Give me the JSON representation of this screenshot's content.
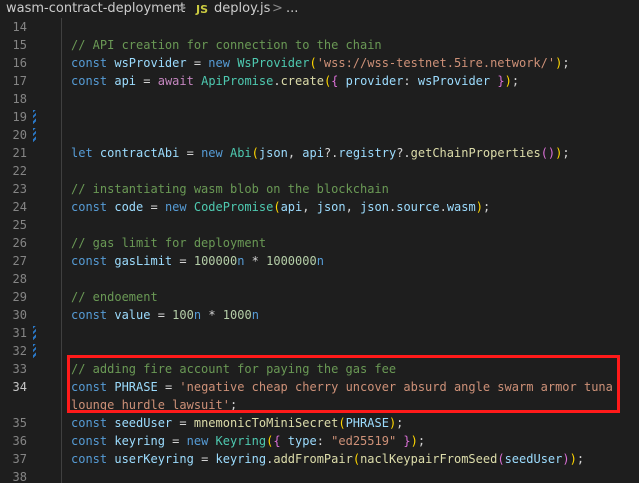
{
  "breadcrumb": {
    "folder": "wasm-contract-deployment",
    "separator": ">",
    "file_icon": "JS",
    "file": "deploy.js",
    "more": "..."
  },
  "lines": [
    {
      "n": "14",
      "tokens": []
    },
    {
      "n": "15",
      "tokens": [
        {
          "t": "// API creation for connection to the chain",
          "c": "c"
        }
      ]
    },
    {
      "n": "16",
      "tokens": [
        {
          "t": "const ",
          "c": "k"
        },
        {
          "t": "wsProvider",
          "c": "v"
        },
        {
          "t": " = ",
          "c": "p"
        },
        {
          "t": "new ",
          "c": "k"
        },
        {
          "t": "WsProvider",
          "c": "cl"
        },
        {
          "t": "(",
          "c": "br1"
        },
        {
          "t": "'wss://wss-testnet.5ire.network/'",
          "c": "s"
        },
        {
          "t": ")",
          "c": "br1"
        },
        {
          "t": ";",
          "c": "p"
        }
      ]
    },
    {
      "n": "17",
      "tokens": [
        {
          "t": "const ",
          "c": "k"
        },
        {
          "t": "api",
          "c": "v"
        },
        {
          "t": " = ",
          "c": "p"
        },
        {
          "t": "await ",
          "c": "kc"
        },
        {
          "t": "ApiPromise",
          "c": "cl"
        },
        {
          "t": ".",
          "c": "p"
        },
        {
          "t": "create",
          "c": "f"
        },
        {
          "t": "(",
          "c": "br1"
        },
        {
          "t": "{ ",
          "c": "br2"
        },
        {
          "t": "provider",
          "c": "v"
        },
        {
          "t": ": ",
          "c": "p"
        },
        {
          "t": "wsProvider",
          "c": "v"
        },
        {
          "t": " }",
          "c": "br2"
        },
        {
          "t": ")",
          "c": "br1"
        },
        {
          "t": ";",
          "c": "p"
        }
      ]
    },
    {
      "n": "18",
      "tokens": []
    },
    {
      "n": "19",
      "tokens": [],
      "mark": true
    },
    {
      "n": "20",
      "tokens": [],
      "mark": true
    },
    {
      "n": "21",
      "tokens": [
        {
          "t": "let ",
          "c": "k"
        },
        {
          "t": "contractAbi",
          "c": "v"
        },
        {
          "t": " = ",
          "c": "p"
        },
        {
          "t": "new ",
          "c": "k"
        },
        {
          "t": "Abi",
          "c": "cl"
        },
        {
          "t": "(",
          "c": "br1"
        },
        {
          "t": "json",
          "c": "v"
        },
        {
          "t": ", ",
          "c": "p"
        },
        {
          "t": "api",
          "c": "v"
        },
        {
          "t": "?.",
          "c": "p"
        },
        {
          "t": "registry",
          "c": "v"
        },
        {
          "t": "?.",
          "c": "p"
        },
        {
          "t": "getChainProperties",
          "c": "f"
        },
        {
          "t": "()",
          "c": "br2"
        },
        {
          "t": ")",
          "c": "br1"
        },
        {
          "t": ";",
          "c": "p"
        }
      ]
    },
    {
      "n": "22",
      "tokens": []
    },
    {
      "n": "23",
      "tokens": [
        {
          "t": "// instantiating wasm blob on the blockchain",
          "c": "c"
        }
      ]
    },
    {
      "n": "24",
      "tokens": [
        {
          "t": "const ",
          "c": "k"
        },
        {
          "t": "code",
          "c": "v"
        },
        {
          "t": " = ",
          "c": "p"
        },
        {
          "t": "new ",
          "c": "k"
        },
        {
          "t": "CodePromise",
          "c": "cl"
        },
        {
          "t": "(",
          "c": "br1"
        },
        {
          "t": "api",
          "c": "v"
        },
        {
          "t": ", ",
          "c": "p"
        },
        {
          "t": "json",
          "c": "v"
        },
        {
          "t": ", ",
          "c": "p"
        },
        {
          "t": "json",
          "c": "v"
        },
        {
          "t": ".",
          "c": "p"
        },
        {
          "t": "source",
          "c": "v"
        },
        {
          "t": ".",
          "c": "p"
        },
        {
          "t": "wasm",
          "c": "v"
        },
        {
          "t": ")",
          "c": "br1"
        },
        {
          "t": ";",
          "c": "p"
        }
      ]
    },
    {
      "n": "25",
      "tokens": []
    },
    {
      "n": "26",
      "tokens": [
        {
          "t": "// gas limit for deployment",
          "c": "c"
        }
      ]
    },
    {
      "n": "27",
      "tokens": [
        {
          "t": "const ",
          "c": "k"
        },
        {
          "t": "gasLimit",
          "c": "v"
        },
        {
          "t": " = ",
          "c": "p"
        },
        {
          "t": "100000",
          "c": "n"
        },
        {
          "t": "n",
          "c": "k"
        },
        {
          "t": " * ",
          "c": "p"
        },
        {
          "t": "1000000",
          "c": "n"
        },
        {
          "t": "n",
          "c": "k"
        }
      ]
    },
    {
      "n": "28",
      "tokens": []
    },
    {
      "n": "29",
      "tokens": [
        {
          "t": "// endoement",
          "c": "c"
        }
      ]
    },
    {
      "n": "30",
      "tokens": [
        {
          "t": "const ",
          "c": "k"
        },
        {
          "t": "value",
          "c": "v"
        },
        {
          "t": " = ",
          "c": "p"
        },
        {
          "t": "100",
          "c": "n"
        },
        {
          "t": "n",
          "c": "k"
        },
        {
          "t": " * ",
          "c": "p"
        },
        {
          "t": "1000",
          "c": "n"
        },
        {
          "t": "n",
          "c": "k"
        }
      ]
    },
    {
      "n": "31",
      "tokens": [],
      "mark": true
    },
    {
      "n": "32",
      "tokens": [],
      "mark": true
    },
    {
      "n": "33",
      "tokens": [
        {
          "t": "// adding fire account for paying the gas fee",
          "c": "c"
        }
      ]
    },
    {
      "n": "34",
      "tall": true,
      "tokens": [
        {
          "t": "const ",
          "c": "k"
        },
        {
          "t": "PHRASE",
          "c": "v"
        },
        {
          "t": " = ",
          "c": "p"
        },
        {
          "t": "'negative cheap cherry uncover absurd angle swarm armor tuna lounge hurdle lawsuit'",
          "c": "s"
        },
        {
          "t": ";",
          "c": "p"
        }
      ]
    },
    {
      "n": "35",
      "tokens": [
        {
          "t": "const ",
          "c": "k"
        },
        {
          "t": "seedUser",
          "c": "v"
        },
        {
          "t": " = ",
          "c": "p"
        },
        {
          "t": "mnemonicToMiniSecret",
          "c": "f"
        },
        {
          "t": "(",
          "c": "br1"
        },
        {
          "t": "PHRASE",
          "c": "v"
        },
        {
          "t": ")",
          "c": "br1"
        },
        {
          "t": ";",
          "c": "p"
        }
      ]
    },
    {
      "n": "36",
      "tokens": [
        {
          "t": "const ",
          "c": "k"
        },
        {
          "t": "keyring",
          "c": "v"
        },
        {
          "t": " = ",
          "c": "p"
        },
        {
          "t": "new ",
          "c": "k"
        },
        {
          "t": "Keyring",
          "c": "cl"
        },
        {
          "t": "(",
          "c": "br1"
        },
        {
          "t": "{ ",
          "c": "br2"
        },
        {
          "t": "type",
          "c": "v"
        },
        {
          "t": ": ",
          "c": "p"
        },
        {
          "t": "\"ed25519\"",
          "c": "s"
        },
        {
          "t": " }",
          "c": "br2"
        },
        {
          "t": ")",
          "c": "br1"
        },
        {
          "t": ";",
          "c": "p"
        }
      ]
    },
    {
      "n": "37",
      "tokens": [
        {
          "t": "const ",
          "c": "k"
        },
        {
          "t": "userKeyring",
          "c": "v"
        },
        {
          "t": " = ",
          "c": "p"
        },
        {
          "t": "keyring",
          "c": "v"
        },
        {
          "t": ".",
          "c": "p"
        },
        {
          "t": "addFromPair",
          "c": "f"
        },
        {
          "t": "(",
          "c": "br1"
        },
        {
          "t": "naclKeypairFromSeed",
          "c": "f"
        },
        {
          "t": "(",
          "c": "br2"
        },
        {
          "t": "seedUser",
          "c": "v"
        },
        {
          "t": ")",
          "c": "br2"
        },
        {
          "t": ")",
          "c": "br1"
        },
        {
          "t": ";",
          "c": "p"
        }
      ]
    },
    {
      "n": "38",
      "tokens": []
    }
  ],
  "highlight": {
    "color": "#ff1a1a",
    "lines": [
      "33",
      "34"
    ]
  }
}
